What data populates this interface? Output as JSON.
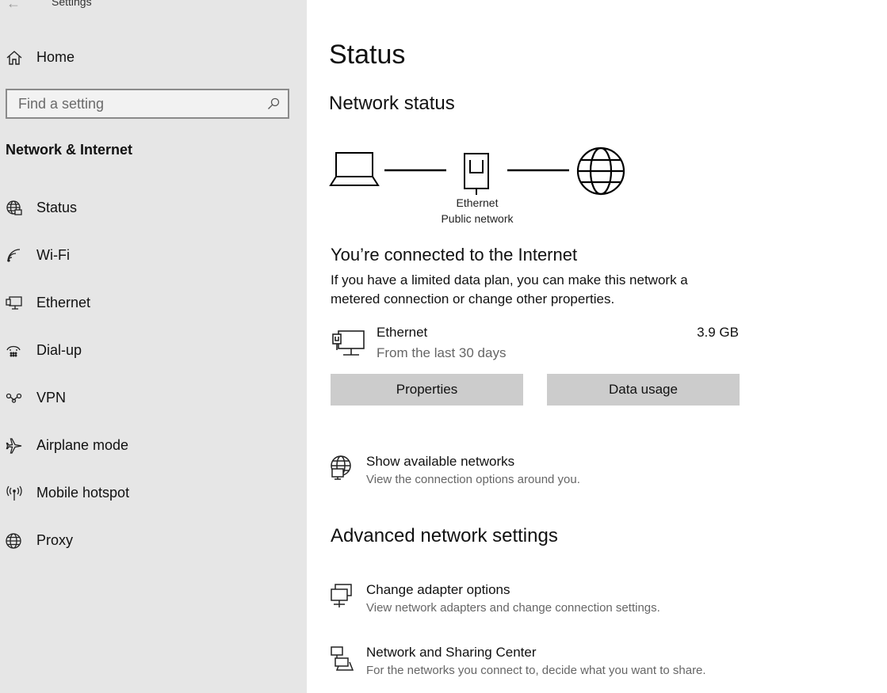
{
  "app": {
    "title": "Settings"
  },
  "sidebar": {
    "home_label": "Home",
    "search_placeholder": "Find a setting",
    "section_title": "Network & Internet",
    "items": [
      {
        "label": "Status",
        "icon": "status-globe-icon"
      },
      {
        "label": "Wi-Fi",
        "icon": "wifi-icon"
      },
      {
        "label": "Ethernet",
        "icon": "ethernet-icon"
      },
      {
        "label": "Dial-up",
        "icon": "dialup-icon"
      },
      {
        "label": "VPN",
        "icon": "vpn-icon"
      },
      {
        "label": "Airplane mode",
        "icon": "airplane-icon"
      },
      {
        "label": "Mobile hotspot",
        "icon": "hotspot-icon"
      },
      {
        "label": "Proxy",
        "icon": "globe-icon"
      }
    ]
  },
  "main": {
    "page_title": "Status",
    "network_status_heading": "Network status",
    "diagram": {
      "adapter_name": "Ethernet",
      "network_type": "Public network"
    },
    "connected_title": "You’re connected to the Internet",
    "connected_desc": "If you have a limited data plan, you can make this network a metered connection or change other properties.",
    "adapter": {
      "name": "Ethernet",
      "period": "From the last 30 days",
      "usage": "3.9 GB"
    },
    "buttons": {
      "properties": "Properties",
      "data_usage": "Data usage"
    },
    "show_networks": {
      "title": "Show available networks",
      "desc": "View the connection options around you."
    },
    "advanced_heading": "Advanced network settings",
    "advanced_links": [
      {
        "title": "Change adapter options",
        "desc": "View network adapters and change connection settings."
      },
      {
        "title": "Network and Sharing Center",
        "desc": "For the networks you connect to, decide what you want to share."
      }
    ]
  }
}
